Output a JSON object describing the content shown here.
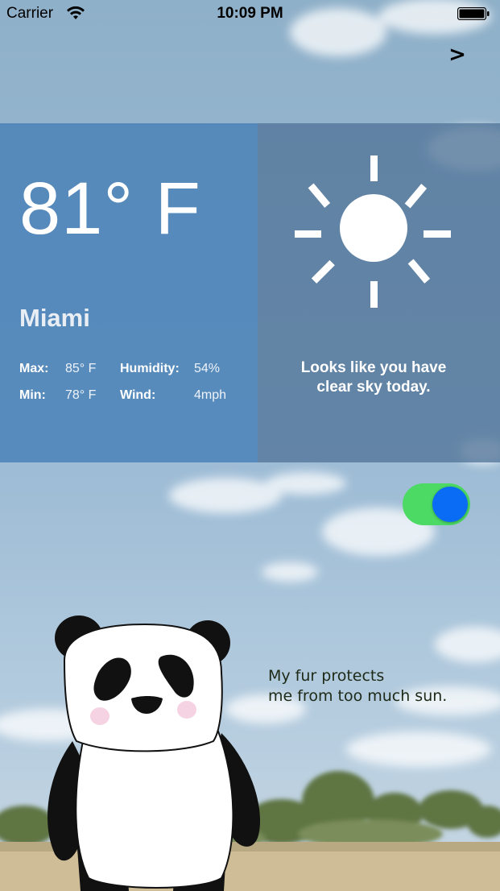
{
  "status_bar": {
    "carrier": "Carrier",
    "time": "10:09 PM"
  },
  "nav": {
    "next_label": ">"
  },
  "weather": {
    "temperature": "81° F",
    "city": "Miami",
    "stats": {
      "max_label": "Max:",
      "max_value": "85° F",
      "min_label": "Min:",
      "min_value": "78° F",
      "humidity_label": "Humidity:",
      "humidity_value": "54%",
      "wind_label": "Wind:",
      "wind_value": "4mph"
    },
    "condition_line1": "Looks like you have",
    "condition_line2": "clear sky today.",
    "icon": "sun-icon"
  },
  "toggle": {
    "on": true,
    "track_color": "#4cd964",
    "knob_color": "#0a6cf5"
  },
  "panda": {
    "quote_line1": "My fur protects",
    "quote_line2": "me from too much sun."
  },
  "colors": {
    "panel_left": "#447eb6",
    "panel_right": "#527498"
  }
}
